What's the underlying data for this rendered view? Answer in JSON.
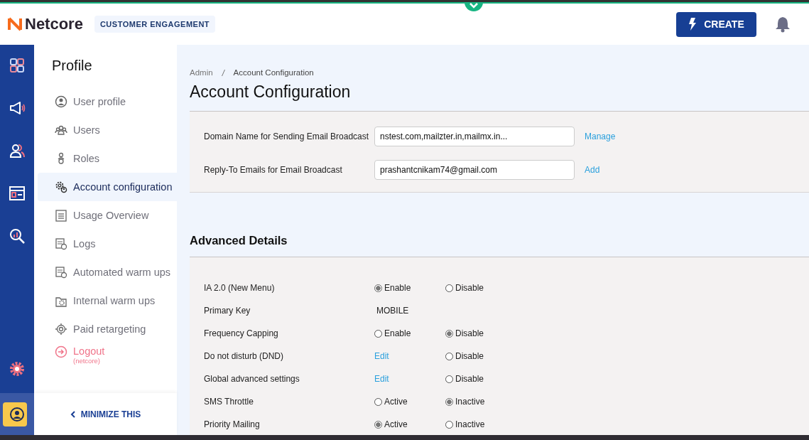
{
  "header": {
    "logo": "Netcore",
    "product": "CUSTOMER ENGAGEMENT",
    "create_button": "CREATE"
  },
  "rail": [
    {
      "kind": "apps",
      "selected": false
    },
    {
      "kind": "megaphone",
      "selected": false
    },
    {
      "kind": "contacts",
      "selected": false
    },
    {
      "kind": "layout",
      "selected": false
    },
    {
      "kind": "analytics",
      "selected": false
    },
    {
      "kind": "settings",
      "selected": false
    },
    {
      "kind": "profile",
      "selected": true
    }
  ],
  "sidebar": {
    "title": "Profile",
    "items": [
      {
        "kind": "user",
        "label": "User profile",
        "selected": false
      },
      {
        "kind": "users",
        "label": "Users",
        "selected": false
      },
      {
        "kind": "role",
        "label": "Roles",
        "selected": false
      },
      {
        "kind": "gears",
        "label": "Account configuration",
        "selected": true
      },
      {
        "kind": "list",
        "label": "Usage Overview",
        "selected": false
      },
      {
        "kind": "log",
        "label": "Logs",
        "selected": false
      },
      {
        "kind": "log",
        "label": "Automated warm ups",
        "selected": false
      },
      {
        "kind": "folder",
        "label": "Internal warm ups",
        "selected": false
      },
      {
        "kind": "target",
        "label": "Paid retargeting",
        "selected": false
      },
      {
        "kind": "logout",
        "label": "Logout",
        "sublabel": "(netcore)",
        "selected": false
      }
    ],
    "minimize": "MINIMIZE THIS"
  },
  "breadcrumb": [
    "Admin",
    "Account Configuration"
  ],
  "title": "Account Configuration",
  "email_settings": [
    {
      "label": "Domain Name for Sending Email Broadcast",
      "value": "nstest.com,mailzter.in,mailmx.in...",
      "action": "Manage"
    },
    {
      "label": "Reply-To Emails for Email Broadcast",
      "value": "prashantcnikam74@gmail.com",
      "action": "Add"
    }
  ],
  "advanced": {
    "title": "Advanced Details",
    "rows": [
      {
        "kind": "radio",
        "label": "IA 2.0 (New Menu)",
        "options": [
          {
            "label": "Enable",
            "selected": true
          },
          {
            "label": "Disable",
            "selected": false
          }
        ]
      },
      {
        "kind": "text",
        "label": "Primary Key",
        "value": "MOBILE"
      },
      {
        "kind": "radio",
        "label": "Frequency Capping",
        "options": [
          {
            "label": "Enable",
            "selected": false
          },
          {
            "label": "Disable",
            "selected": true
          }
        ]
      },
      {
        "kind": "edit",
        "label": "Do not disturb (DND)",
        "action": "Edit",
        "options": [
          {
            "label": "Disable",
            "selected": false
          }
        ]
      },
      {
        "kind": "edit",
        "label": "Global advanced settings",
        "action": "Edit",
        "options": [
          {
            "label": "Disable",
            "selected": false
          }
        ]
      },
      {
        "kind": "radio",
        "label": "SMS Throttle",
        "options": [
          {
            "label": "Active",
            "selected": false
          },
          {
            "label": "Inactive",
            "selected": true
          }
        ]
      },
      {
        "kind": "radio",
        "label": "Priority Mailing",
        "options": [
          {
            "label": "Active",
            "selected": true
          },
          {
            "label": "Inactive",
            "selected": false
          }
        ]
      }
    ]
  }
}
